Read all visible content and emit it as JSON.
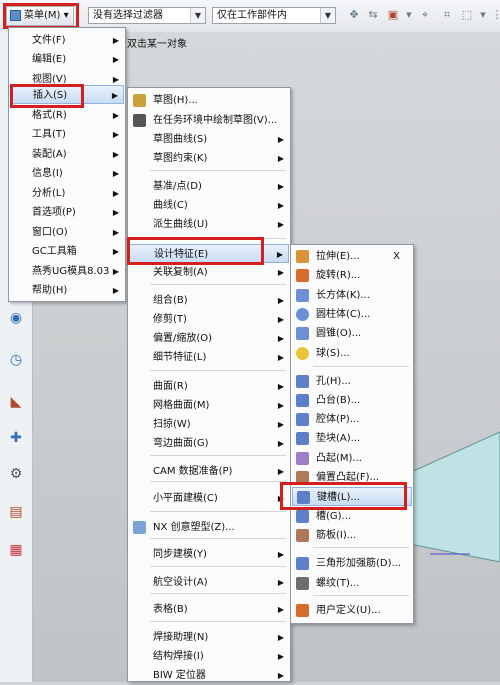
{
  "toolbar": {
    "menu_label": "菜单(M) ▾",
    "filter": "没有选择过滤器",
    "scope": "仅在工作部件内"
  },
  "viewport": {
    "hint": "双击某一对象"
  },
  "menu_main": [
    {
      "label": "文件(F)",
      "sub": true
    },
    {
      "label": "编辑(E)",
      "sub": true
    },
    {
      "label": "视图(V)",
      "sub": true
    },
    {
      "label": "插入(S)",
      "sub": true,
      "selected": true
    },
    {
      "label": "格式(R)",
      "sub": true
    },
    {
      "label": "工具(T)",
      "sub": true
    },
    {
      "label": "装配(A)",
      "sub": true
    },
    {
      "label": "信息(I)",
      "sub": true
    },
    {
      "label": "分析(L)",
      "sub": true
    },
    {
      "label": "首选项(P)",
      "sub": true
    },
    {
      "label": "窗口(O)",
      "sub": true
    },
    {
      "label": "GC工具箱",
      "sub": true
    },
    {
      "label": "燕秀UG模具8.03",
      "sub": true
    },
    {
      "label": "帮助(H)",
      "sub": true
    }
  ],
  "menu_insert": [
    {
      "label": "草图(H)...",
      "icon": "sketch-icon",
      "sub": false
    },
    {
      "label": "在任务环境中绘制草图(V)...",
      "icon": "sketch-task-icon",
      "sub": false
    },
    {
      "label": "草图曲线(S)",
      "sub": true
    },
    {
      "label": "草图约束(K)",
      "sub": true
    },
    {
      "label": "基准/点(D)",
      "sub": true
    },
    {
      "label": "曲线(C)",
      "sub": true
    },
    {
      "label": "派生曲线(U)",
      "sub": true
    },
    {
      "label": "设计特征(E)",
      "sub": true,
      "selected": true
    },
    {
      "label": "关联复制(A)",
      "sub": true
    },
    {
      "label": "组合(B)",
      "sub": true
    },
    {
      "label": "修剪(T)",
      "sub": true
    },
    {
      "label": "偏置/缩放(O)",
      "sub": true
    },
    {
      "label": "细节特征(L)",
      "sub": true
    },
    {
      "label": "曲面(R)",
      "sub": true
    },
    {
      "label": "网格曲面(M)",
      "sub": true
    },
    {
      "label": "扫掠(W)",
      "sub": true
    },
    {
      "label": "弯边曲面(G)",
      "sub": true
    },
    {
      "label": "CAM 数据准备(P)",
      "sub": true
    },
    {
      "label": "小平面建模(C)",
      "sub": true
    },
    {
      "label": "NX 创意塑型(Z)...",
      "icon": "nx-realize-icon",
      "sub": false
    },
    {
      "label": "同步建模(Y)",
      "sub": true
    },
    {
      "label": "航空设计(A)",
      "sub": true
    },
    {
      "label": "表格(B)",
      "sub": true
    },
    {
      "label": "焊接助理(N)",
      "sub": true
    },
    {
      "label": "结构焊接(I)",
      "sub": true
    },
    {
      "label": "BIW 定位器",
      "sub": true
    }
  ],
  "menu_design": [
    {
      "label": "拉伸(E)...",
      "icon": "extrude-icon",
      "close": "X"
    },
    {
      "label": "旋转(R)...",
      "icon": "revolve-icon"
    },
    {
      "label": "长方体(K)...",
      "icon": "block-icon"
    },
    {
      "label": "圆柱体(C)...",
      "icon": "cylinder-icon"
    },
    {
      "label": "圆锥(O)...",
      "icon": "cone-icon"
    },
    {
      "label": "球(S)...",
      "icon": "sphere-icon"
    },
    {
      "label": "孔(H)...",
      "icon": "hole-icon"
    },
    {
      "label": "凸台(B)...",
      "icon": "boss-icon"
    },
    {
      "label": "腔体(P)...",
      "icon": "pocket-icon"
    },
    {
      "label": "垫块(A)...",
      "icon": "pad-icon"
    },
    {
      "label": "凸起(M)...",
      "icon": "emboss-icon"
    },
    {
      "label": "偏置凸起(F)...",
      "icon": "offset-emboss-icon"
    },
    {
      "label": "键槽(L)...",
      "icon": "slot-icon",
      "selected": true
    },
    {
      "label": "槽(G)...",
      "icon": "groove-icon"
    },
    {
      "label": "筋板(I)...",
      "icon": "rib-icon"
    },
    {
      "label": "三角形加强筋(D)...",
      "icon": "dart-icon"
    },
    {
      "label": "螺纹(T)...",
      "icon": "thread-icon"
    },
    {
      "label": "用户定义(U)...",
      "icon": "user-defined-icon"
    }
  ],
  "colors": {
    "highlight_box": "#d41f1f",
    "selection": "#c9dcf3"
  }
}
